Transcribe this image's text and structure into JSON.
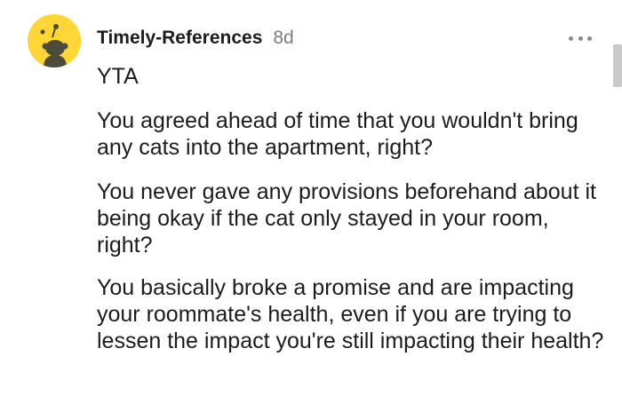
{
  "comment": {
    "username": "Timely-References",
    "age": "8d",
    "verdict": "YTA",
    "paragraphs": [
      "You agreed ahead of time that you wouldn't bring any cats into the apartment, right?",
      "You never gave any provisions beforehand about it being okay if the cat only stayed in your room, right?",
      "You basically broke a promise and are impacting your roommate's health, even if you are trying to lessen the impact you're still impacting their health?"
    ]
  },
  "icons": {
    "avatar": "snoo-avatar-icon",
    "more": "more-options-icon"
  },
  "colors": {
    "avatar_bg": "#ffd635",
    "text": "#1c1c1c",
    "meta": "#7c7c7c"
  }
}
